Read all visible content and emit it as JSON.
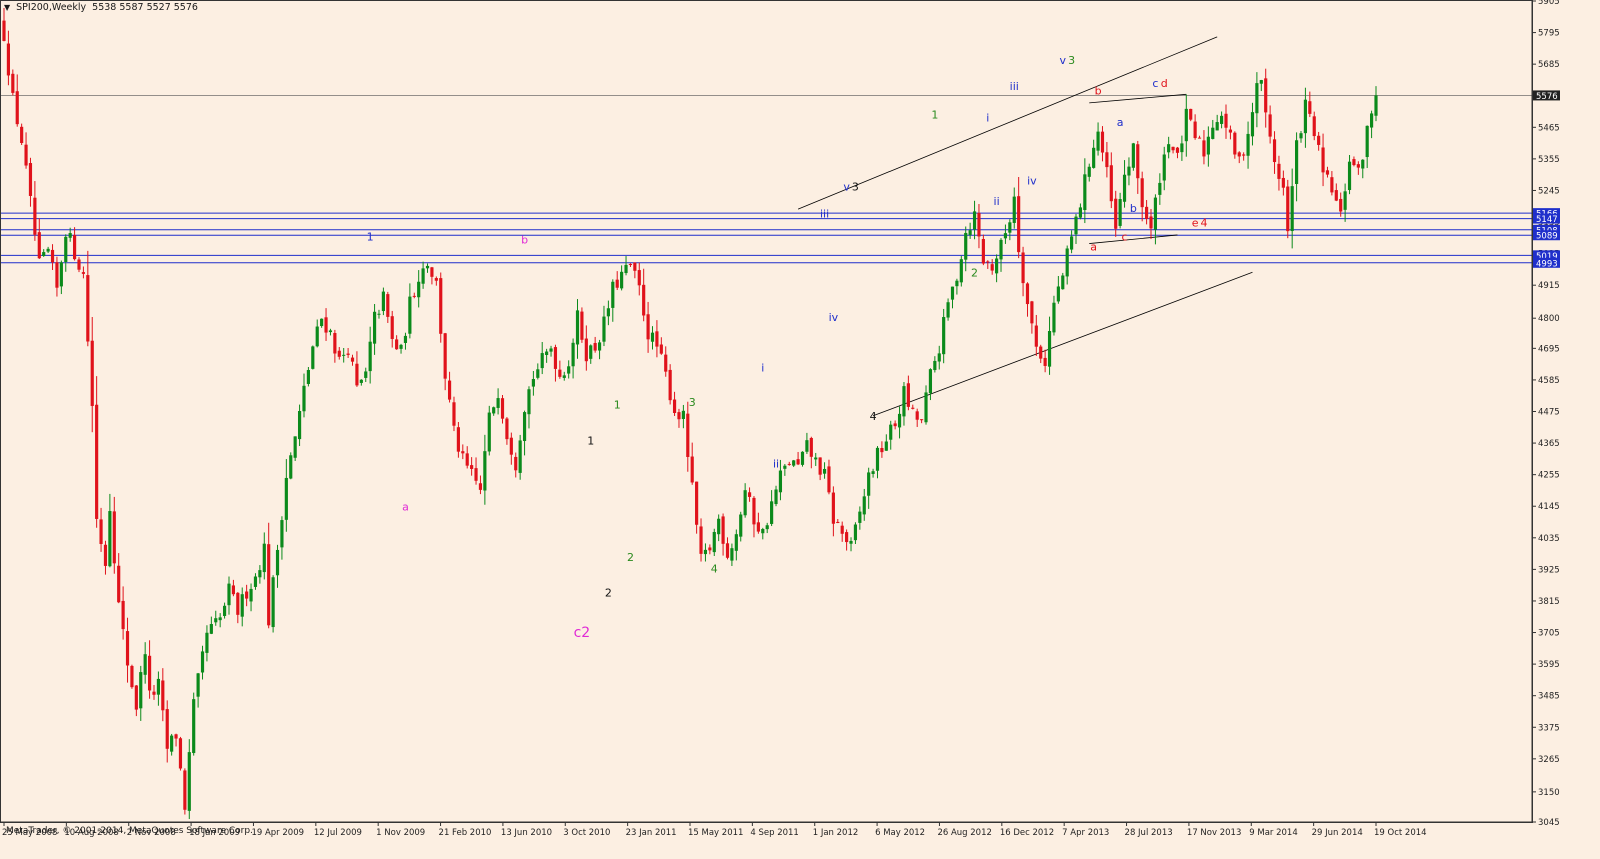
{
  "header": {
    "menu_glyph": "▼",
    "title": "SPI200,Weekly",
    "ohlc": "5538 5587 5527 5576"
  },
  "footer": {
    "copyright": "MetaTrader, © 2001-2014, MetaQuotes Software Corp."
  },
  "colors": {
    "background": "#FCEFE2",
    "bull_candle": "#0B8A1B",
    "bear_candle": "#E0121B",
    "support_lines": "#1F2FCB",
    "trend_lines": "#000000",
    "label_magenta": "#E02AD6",
    "label_black": "#111111",
    "label_green": "#2A8A1E",
    "label_blue": "#1F2FCB",
    "label_red": "#E0121B"
  },
  "chart_data": {
    "type": "candlestick",
    "symbol": "SPI200",
    "timeframe": "Weekly",
    "ylim": [
      3045,
      5905
    ],
    "y_tick_labels": [
      "5905",
      "5795",
      "5685",
      "5575",
      "5465",
      "5355",
      "5245",
      "5135",
      "5025",
      "4915",
      "4800",
      "4695",
      "4585",
      "4475",
      "4365",
      "4255",
      "4145",
      "4035",
      "3925",
      "3815",
      "3705",
      "3595",
      "3485",
      "3375",
      "3265",
      "3150",
      "3045"
    ],
    "x_tick_labels": [
      "25 May 2008",
      "10 Aug 2008",
      "2 Nov 2008",
      "18 Jan 2009",
      "19 Apr 2009",
      "12 Jul 2009",
      "1 Nov 2009",
      "21 Feb 2010",
      "13 Jun 2010",
      "3 Oct 2010",
      "23 Jan 2011",
      "15 May 2011",
      "4 Sep 2011",
      "1 Jan 2012",
      "6 May 2012",
      "26 Aug 2012",
      "16 Dec 2012",
      "7 Apr 2013",
      "28 Jul 2013",
      "17 Nov 2013",
      "9 Mar 2014",
      "29 Jun 2014",
      "19 Oct 2014"
    ],
    "current_price": 5576,
    "horizontal_levels": [
      5166,
      5147,
      5108,
      5089,
      5019,
      4993
    ],
    "horizontal_level_labels": [
      "5166",
      "5147",
      "5108",
      "5089",
      "5019",
      "4993"
    ],
    "price_path": [
      [
        0,
        5790
      ],
      [
        2,
        5560
      ],
      [
        4,
        5420
      ],
      [
        6,
        5200
      ],
      [
        8,
        4980
      ],
      [
        10,
        5030
      ],
      [
        12,
        4900
      ],
      [
        14,
        5110
      ],
      [
        16,
        5030
      ],
      [
        18,
        4950
      ],
      [
        20,
        4500
      ],
      [
        21,
        4100
      ],
      [
        23,
        3950
      ],
      [
        24,
        4150
      ],
      [
        26,
        3800
      ],
      [
        28,
        3600
      ],
      [
        30,
        3450
      ],
      [
        32,
        3650
      ],
      [
        33,
        3480
      ],
      [
        35,
        3520
      ],
      [
        37,
        3300
      ],
      [
        39,
        3350
      ],
      [
        41,
        3100
      ],
      [
        43,
        3450
      ],
      [
        46,
        3700
      ],
      [
        49,
        3750
      ],
      [
        51,
        3850
      ],
      [
        53,
        3780
      ],
      [
        55,
        3850
      ],
      [
        57,
        3900
      ],
      [
        59,
        4000
      ],
      [
        60,
        3750
      ],
      [
        62,
        4000
      ],
      [
        64,
        4250
      ],
      [
        66,
        4380
      ],
      [
        68,
        4550
      ],
      [
        70,
        4700
      ],
      [
        72,
        4800
      ],
      [
        74,
        4750
      ],
      [
        76,
        4650
      ],
      [
        78,
        4700
      ],
      [
        80,
        4550
      ],
      [
        82,
        4600
      ],
      [
        84,
        4800
      ],
      [
        86,
        4870
      ],
      [
        88,
        4720
      ],
      [
        90,
        4680
      ],
      [
        92,
        4850
      ],
      [
        94,
        4950
      ],
      [
        96,
        5000
      ],
      [
        98,
        4920
      ],
      [
        100,
        4600
      ],
      [
        102,
        4400
      ],
      [
        104,
        4300
      ],
      [
        106,
        4250
      ],
      [
        108,
        4200
      ],
      [
        110,
        4450
      ],
      [
        112,
        4550
      ],
      [
        114,
        4400
      ],
      [
        116,
        4300
      ],
      [
        118,
        4500
      ],
      [
        120,
        4600
      ],
      [
        122,
        4650
      ],
      [
        124,
        4700
      ],
      [
        126,
        4600
      ],
      [
        128,
        4650
      ],
      [
        130,
        4800
      ],
      [
        132,
        4680
      ],
      [
        134,
        4700
      ],
      [
        136,
        4780
      ],
      [
        138,
        4900
      ],
      [
        140,
        4950
      ],
      [
        142,
        4980
      ],
      [
        144,
        4900
      ],
      [
        146,
        4750
      ],
      [
        148,
        4700
      ],
      [
        150,
        4600
      ],
      [
        152,
        4480
      ],
      [
        154,
        4450
      ],
      [
        156,
        4200
      ],
      [
        158,
        3950
      ],
      [
        160,
        4000
      ],
      [
        162,
        4100
      ],
      [
        164,
        3980
      ],
      [
        166,
        4050
      ],
      [
        168,
        4200
      ],
      [
        170,
        4100
      ],
      [
        172,
        4050
      ],
      [
        174,
        4150
      ],
      [
        176,
        4250
      ],
      [
        178,
        4300
      ],
      [
        180,
        4280
      ],
      [
        182,
        4350
      ],
      [
        184,
        4300
      ],
      [
        186,
        4250
      ],
      [
        188,
        4100
      ],
      [
        190,
        4050
      ],
      [
        192,
        4000
      ],
      [
        194,
        4120
      ],
      [
        196,
        4250
      ],
      [
        198,
        4320
      ],
      [
        200,
        4380
      ],
      [
        202,
        4430
      ],
      [
        204,
        4540
      ],
      [
        206,
        4460
      ],
      [
        208,
        4440
      ],
      [
        210,
        4600
      ],
      [
        212,
        4700
      ],
      [
        214,
        4850
      ],
      [
        216,
        4950
      ],
      [
        218,
        5100
      ],
      [
        220,
        5160
      ],
      [
        222,
        5000
      ],
      [
        224,
        4980
      ],
      [
        226,
        5050
      ],
      [
        228,
        5150
      ],
      [
        229,
        5230
      ],
      [
        230,
        5050
      ],
      [
        232,
        4850
      ],
      [
        234,
        4700
      ],
      [
        236,
        4650
      ],
      [
        238,
        4850
      ],
      [
        240,
        4950
      ],
      [
        242,
        5080
      ],
      [
        244,
        5200
      ],
      [
        246,
        5350
      ],
      [
        248,
        5450
      ],
      [
        250,
        5300
      ],
      [
        252,
        5100
      ],
      [
        254,
        5300
      ],
      [
        256,
        5380
      ],
      [
        258,
        5200
      ],
      [
        260,
        5100
      ],
      [
        262,
        5300
      ],
      [
        264,
        5430
      ],
      [
        266,
        5350
      ],
      [
        268,
        5500
      ],
      [
        270,
        5430
      ],
      [
        272,
        5380
      ],
      [
        274,
        5480
      ],
      [
        276,
        5520
      ],
      [
        278,
        5420
      ],
      [
        280,
        5340
      ],
      [
        282,
        5450
      ],
      [
        284,
        5600
      ],
      [
        285,
        5640
      ],
      [
        286,
        5500
      ],
      [
        288,
        5350
      ],
      [
        290,
        5250
      ],
      [
        291,
        5100
      ],
      [
        293,
        5400
      ],
      [
        295,
        5540
      ],
      [
        297,
        5450
      ],
      [
        299,
        5300
      ],
      [
        301,
        5250
      ],
      [
        303,
        5150
      ],
      [
        305,
        5360
      ],
      [
        307,
        5300
      ],
      [
        309,
        5450
      ],
      [
        311,
        5576
      ]
    ]
  },
  "annotations": [
    {
      "text": "1",
      "color": "blue",
      "week": 83,
      "price": 5070
    },
    {
      "text": "a",
      "color": "magenta",
      "week": 91,
      "price": 4130
    },
    {
      "text": "b",
      "color": "magenta",
      "week": 118,
      "price": 5060
    },
    {
      "text": "c2",
      "color": "magenta",
      "week": 131,
      "price": 3690
    },
    {
      "text": "1",
      "color": "black",
      "week": 133,
      "price": 4360
    },
    {
      "text": "2",
      "color": "black",
      "week": 137,
      "price": 3830
    },
    {
      "text": "1",
      "color": "green",
      "week": 139,
      "price": 4485
    },
    {
      "text": "2",
      "color": "green",
      "week": 142,
      "price": 3955
    },
    {
      "text": "3",
      "color": "green",
      "week": 156,
      "price": 4495
    },
    {
      "text": "4",
      "color": "green",
      "week": 161,
      "price": 3915
    },
    {
      "text": "i",
      "color": "blue",
      "week": 172,
      "price": 4615
    },
    {
      "text": "ii",
      "color": "blue",
      "week": 175,
      "price": 4280
    },
    {
      "text": "iii",
      "color": "blue",
      "week": 186,
      "price": 5150
    },
    {
      "text": "iv",
      "color": "blue",
      "week": 188,
      "price": 4790
    },
    {
      "text": "v",
      "color": "blue",
      "week": 191,
      "price": 5245
    },
    {
      "text": "3",
      "color": "black",
      "week": 193,
      "price": 5245
    },
    {
      "text": "4",
      "color": "black",
      "week": 197,
      "price": 4445
    },
    {
      "text": "1",
      "color": "green",
      "week": 211,
      "price": 5495
    },
    {
      "text": "2",
      "color": "green",
      "week": 220,
      "price": 4945
    },
    {
      "text": "i",
      "color": "blue",
      "week": 223,
      "price": 5485
    },
    {
      "text": "ii",
      "color": "blue",
      "week": 225,
      "price": 5195
    },
    {
      "text": "iii",
      "color": "blue",
      "week": 229,
      "price": 5595
    },
    {
      "text": "iv",
      "color": "blue",
      "week": 233,
      "price": 5265
    },
    {
      "text": "v",
      "color": "blue",
      "week": 240,
      "price": 5685
    },
    {
      "text": "3",
      "color": "green",
      "week": 242,
      "price": 5685
    },
    {
      "text": "b",
      "color": "red",
      "week": 248,
      "price": 5580
    },
    {
      "text": "a",
      "color": "red",
      "week": 247,
      "price": 5035
    },
    {
      "text": "a",
      "color": "blue",
      "week": 253,
      "price": 5470
    },
    {
      "text": "b",
      "color": "blue",
      "week": 256,
      "price": 5170
    },
    {
      "text": "c",
      "color": "red",
      "week": 254,
      "price": 5070
    },
    {
      "text": "c",
      "color": "blue",
      "week": 261,
      "price": 5605
    },
    {
      "text": "d",
      "color": "red",
      "week": 263,
      "price": 5605
    },
    {
      "text": "e",
      "color": "red",
      "week": 270,
      "price": 5120
    },
    {
      "text": "4",
      "color": "red",
      "week": 272,
      "price": 5120
    }
  ]
}
